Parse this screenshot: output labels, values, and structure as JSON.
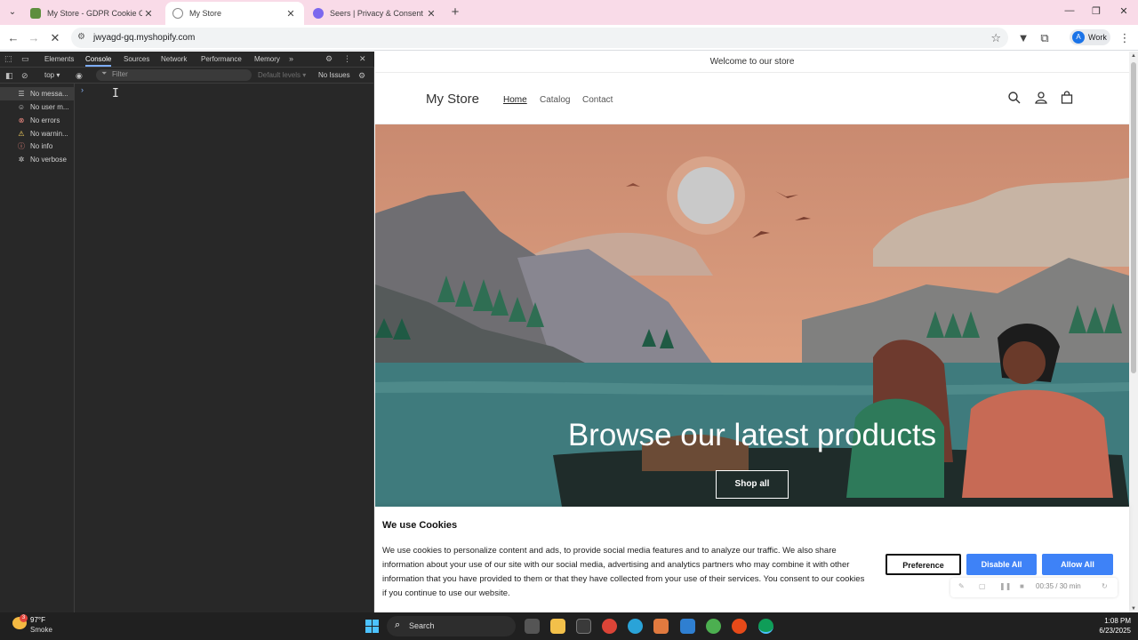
{
  "browser": {
    "tabs": [
      {
        "label": "My Store - GDPR Cookie Conse",
        "active": false
      },
      {
        "label": "My Store",
        "active": true
      },
      {
        "label": "Seers | Privacy & Consent Mana",
        "active": false
      }
    ],
    "url": "jwyagd-gq.myshopify.com",
    "profile_initial": "A",
    "profile_label": "Work"
  },
  "devtools": {
    "tabs": [
      "Elements",
      "Console",
      "Sources",
      "Network",
      "Performance",
      "Memory"
    ],
    "active_tab": "Console",
    "context": "top",
    "filter_placeholder": "Filter",
    "levels": "Default levels",
    "issues": "No Issues",
    "sidebar": [
      {
        "label": "No messa...",
        "icon": "list-icon"
      },
      {
        "label": "No user m...",
        "icon": "user-icon"
      },
      {
        "label": "No errors",
        "icon": "error-icon"
      },
      {
        "label": "No warnin...",
        "icon": "warning-icon"
      },
      {
        "label": "No info",
        "icon": "info-icon"
      },
      {
        "label": "No verbose",
        "icon": "bug-icon"
      }
    ]
  },
  "store": {
    "announcement": "Welcome to our store",
    "logo": "My Store",
    "nav": [
      "Home",
      "Catalog",
      "Contact"
    ],
    "hero_title": "Browse our latest products",
    "shop_button": "Shop all"
  },
  "cookie": {
    "title": "We use Cookies",
    "text": "We use cookies to personalize content and ads, to provide social media features and to analyze our traffic. We also share information about your use of our site with our social media, advertising and analytics partners who may combine it with other information that you have provided to them or that they have collected from your use of their services. You consent to our cookies if you continue to use our website.",
    "preference": "Preference",
    "disable_all": "Disable All",
    "allow_all": "Allow All",
    "recorder_time": "00:35 / 30 min"
  },
  "taskbar": {
    "temp": "97°F",
    "weather": "Smoke",
    "weather_badge": "3",
    "search": "Search",
    "time": "1:08 PM",
    "date": "6/23/2025"
  },
  "colors": {
    "tabstrip": "#f9dbe8",
    "accent_button": "#3e82f7",
    "devtools_bg": "#282828",
    "taskbar": "#202020"
  }
}
